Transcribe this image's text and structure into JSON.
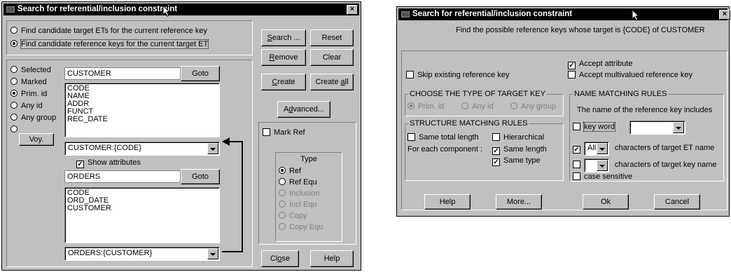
{
  "left": {
    "title": "Search for referential/inclusion constraint",
    "close": "×",
    "mode": [
      {
        "label": "Find candidate target ETs for the current reference key",
        "on": false
      },
      {
        "label": "Find candidate reference keys for the current target ET",
        "on": true
      }
    ],
    "buttons": {
      "search": "Search ...",
      "reset": "Reset",
      "remove": "Remove",
      "clear": "Clear",
      "create": "Create",
      "create_all": "Create all",
      "advanced": "Advanced...",
      "close": "Close",
      "help": "Help",
      "goto1": "Goto",
      "goto2": "Goto",
      "voy": "Voy."
    },
    "selection": [
      {
        "label": "Selected",
        "on": false
      },
      {
        "label": "Marked",
        "on": false
      },
      {
        "label": "Prim. id",
        "on": true
      },
      {
        "label": "Any id",
        "on": false
      },
      {
        "label": "Any group",
        "on": false
      }
    ],
    "et1": {
      "name": "CUSTOMER",
      "items": [
        "CODE",
        "NAME",
        "ADDR",
        "FUNCT",
        "REC_DATE"
      ],
      "combo": "CUSTOMER:{CODE}"
    },
    "show_attributes": "Show attributes",
    "et2": {
      "name": "ORDERS",
      "items": [
        "CODE",
        "ORD_DATE",
        "CUSTOMER"
      ],
      "combo": "ORDERS:{CUSTOMER}"
    },
    "mark_ref": "Mark Ref",
    "type": {
      "title": "Type",
      "items": [
        {
          "label": "Ref",
          "on": true,
          "enabled": true
        },
        {
          "label": "Ref Equ",
          "on": false,
          "enabled": true
        },
        {
          "label": "Inclusion",
          "on": false,
          "enabled": false
        },
        {
          "label": "Incl Equ",
          "on": false,
          "enabled": false
        },
        {
          "label": "Copy",
          "on": false,
          "enabled": false
        },
        {
          "label": "Copy Equ",
          "on": false,
          "enabled": false
        }
      ]
    }
  },
  "right": {
    "title": "Search for referential/inclusion constraint",
    "close": "×",
    "heading": "Find the possible reference keys whose target is {CODE} of CUSTOMER",
    "accept_attribute": "Accept attribute",
    "skip_existing": "Skip existing reference key",
    "accept_multivalued": "Accept multivalued reference key",
    "target_type": {
      "title": "CHOOSE THE TYPE OF TARGET KEY",
      "items": [
        {
          "label": "Prim. id",
          "on": true
        },
        {
          "label": "Any id",
          "on": false
        },
        {
          "label": "Any group",
          "on": false
        }
      ]
    },
    "structure": {
      "title": "STRUCTURE MATCHING RULES",
      "same_total_length": "Same total length",
      "hierarchical": "Hierarchical",
      "for_each": "For each component :",
      "same_length": "Same length",
      "same_type": "Same type"
    },
    "name_rules": {
      "title": "NAME MATCHING RULES",
      "desc": "The name of the reference key includes",
      "key_word": "key word",
      "all": "All",
      "target_et": "characters of target ET name",
      "target_key": "characters of target key name",
      "case_sensitive": "case sensitive"
    },
    "buttons": {
      "help": "Help",
      "more": "More...",
      "ok": "Ok",
      "cancel": "Cancel"
    }
  }
}
